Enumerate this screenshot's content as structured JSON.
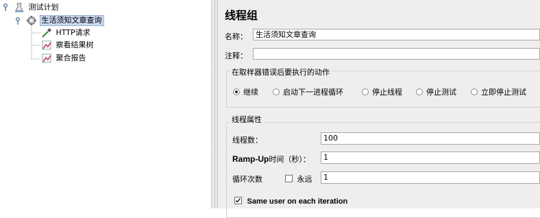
{
  "tree": {
    "items": [
      {
        "label": "测试计划"
      },
      {
        "label": "生活须知文章查询"
      },
      {
        "label": "HTTP请求"
      },
      {
        "label": "察看结果树"
      },
      {
        "label": "聚合报告"
      }
    ]
  },
  "panel": {
    "title": "线程组",
    "name_label": "名称：",
    "name_value": "生活须知文章查询",
    "comment_label": "注释：",
    "comment_value": "",
    "action_group": {
      "title": "在取样器错误后要执行的动作",
      "options": [
        "继续",
        "启动下一进程循环",
        "停止线程",
        "停止测试",
        "立即停止测试"
      ],
      "selected": "继续"
    },
    "thread_props": {
      "title": "线程属性",
      "threads_label": "线程数：",
      "threads_value": "100",
      "rampup_label_bold": "Ramp-Up",
      "rampup_label_rest": "时间（秒）：",
      "rampup_value": "1",
      "loop_label": "循环次数",
      "forever_label": "永远",
      "forever_checked": false,
      "loop_value": "1",
      "same_user_label": "Same user on each iteration",
      "same_user_checked": true
    }
  }
}
